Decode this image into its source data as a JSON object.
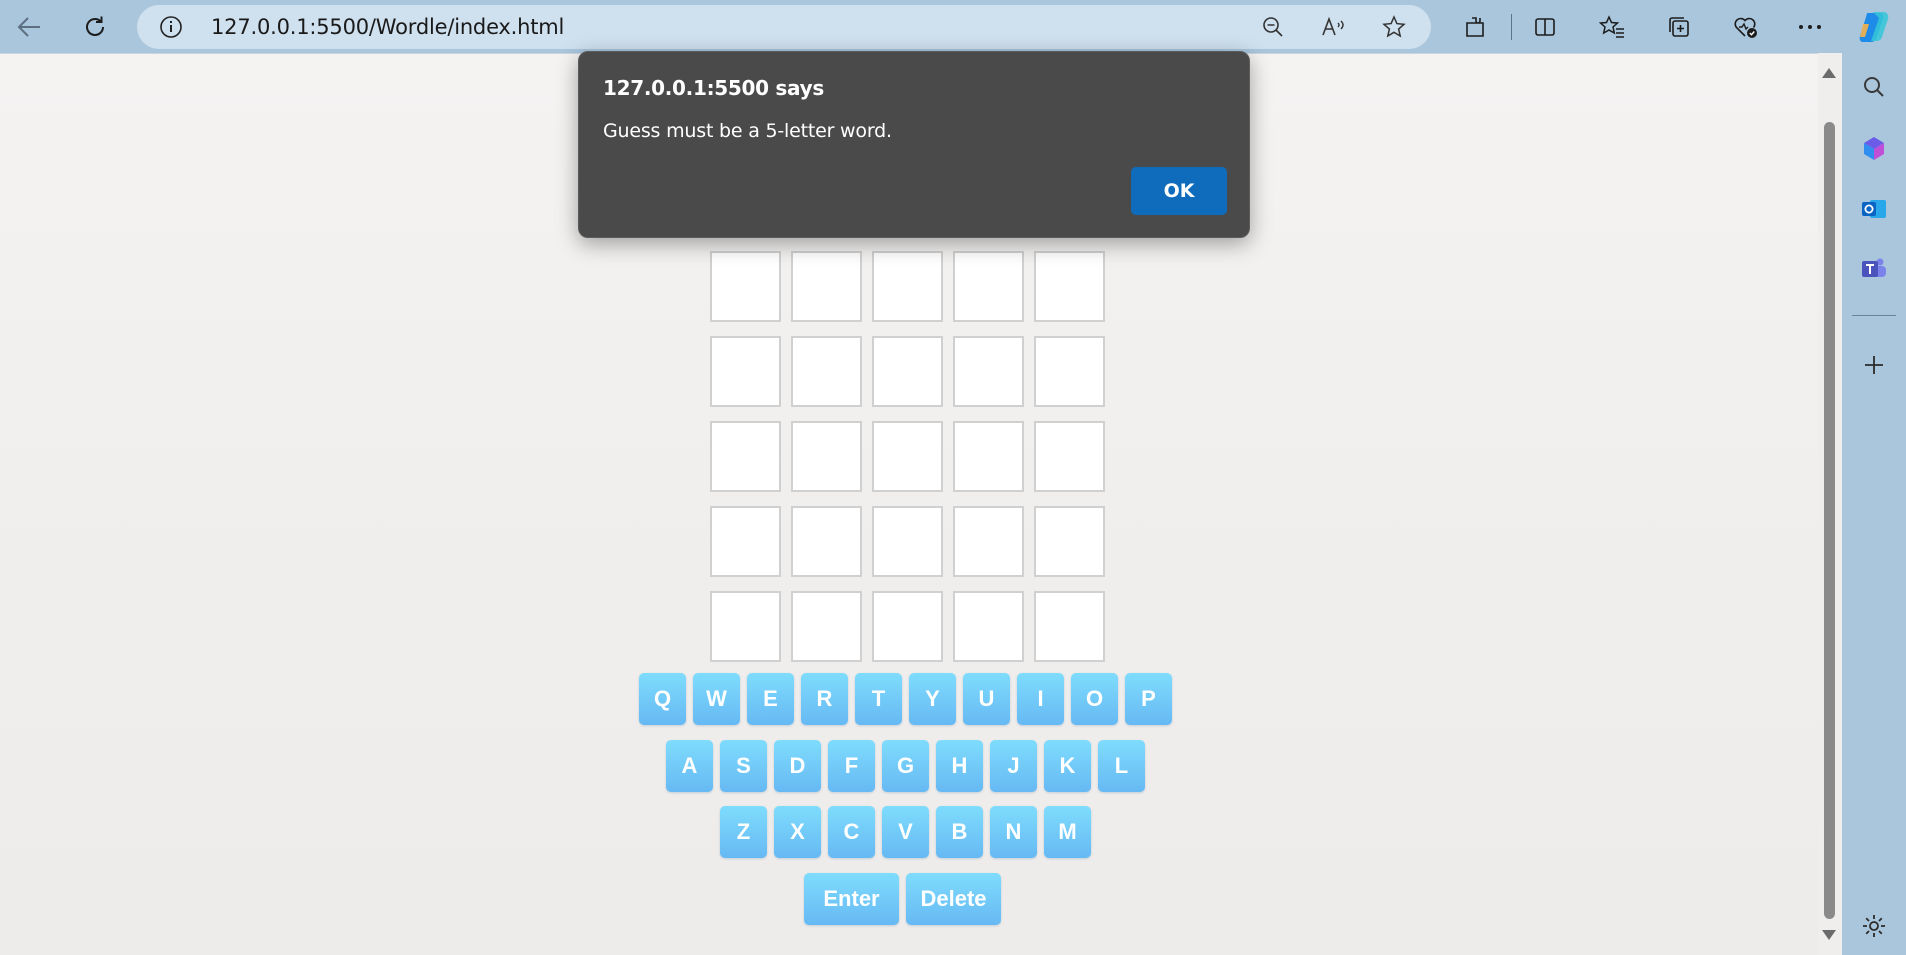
{
  "browser": {
    "address_url": "127.0.0.1:5500/Wordle/index.html",
    "nav": {
      "back_icon": "back-arrow-icon",
      "refresh_icon": "refresh-icon",
      "info_icon": "site-info-icon"
    },
    "address_actions": [
      "zoom-out-icon",
      "read-aloud-icon",
      "favorite-star-icon"
    ],
    "toolbar_icons": [
      "extensions-icon",
      "split-screen-icon",
      "favorites-icon",
      "collections-icon",
      "browser-essentials-icon",
      "more-menu-icon",
      "copilot-icon"
    ],
    "sidebar_icons": [
      "search-icon",
      "copilot-sidebar-icon",
      "outlook-icon",
      "teams-icon",
      "add-icon",
      "settings-icon"
    ],
    "colors": {
      "chrome_bg": "#a9c6dd",
      "address_bg": "#cfe0ee"
    }
  },
  "game": {
    "rows": 6,
    "columns": 5,
    "tiles": [
      [
        "",
        "",
        "",
        "",
        ""
      ],
      [
        "",
        "",
        "",
        "",
        ""
      ],
      [
        "",
        "",
        "",
        "",
        ""
      ],
      [
        "",
        "",
        "",
        "",
        ""
      ],
      [
        "",
        "",
        "",
        "",
        ""
      ],
      [
        "",
        "",
        "",
        "",
        ""
      ]
    ]
  },
  "keyboard": {
    "row1": [
      "Q",
      "W",
      "E",
      "R",
      "T",
      "Y",
      "U",
      "I",
      "O",
      "P"
    ],
    "row2": [
      "A",
      "S",
      "D",
      "F",
      "G",
      "H",
      "J",
      "K",
      "L"
    ],
    "row3": [
      "Z",
      "X",
      "C",
      "V",
      "B",
      "N",
      "M"
    ],
    "actions": {
      "enter": "Enter",
      "delete": "Delete"
    },
    "key_color": "#6ec8f7"
  },
  "dialog": {
    "title": "127.0.0.1:5500 says",
    "message": "Guess must be a 5-letter word.",
    "ok_label": "OK",
    "ok_color": "#0f6cbd",
    "bg_color": "#4a4a4a"
  }
}
